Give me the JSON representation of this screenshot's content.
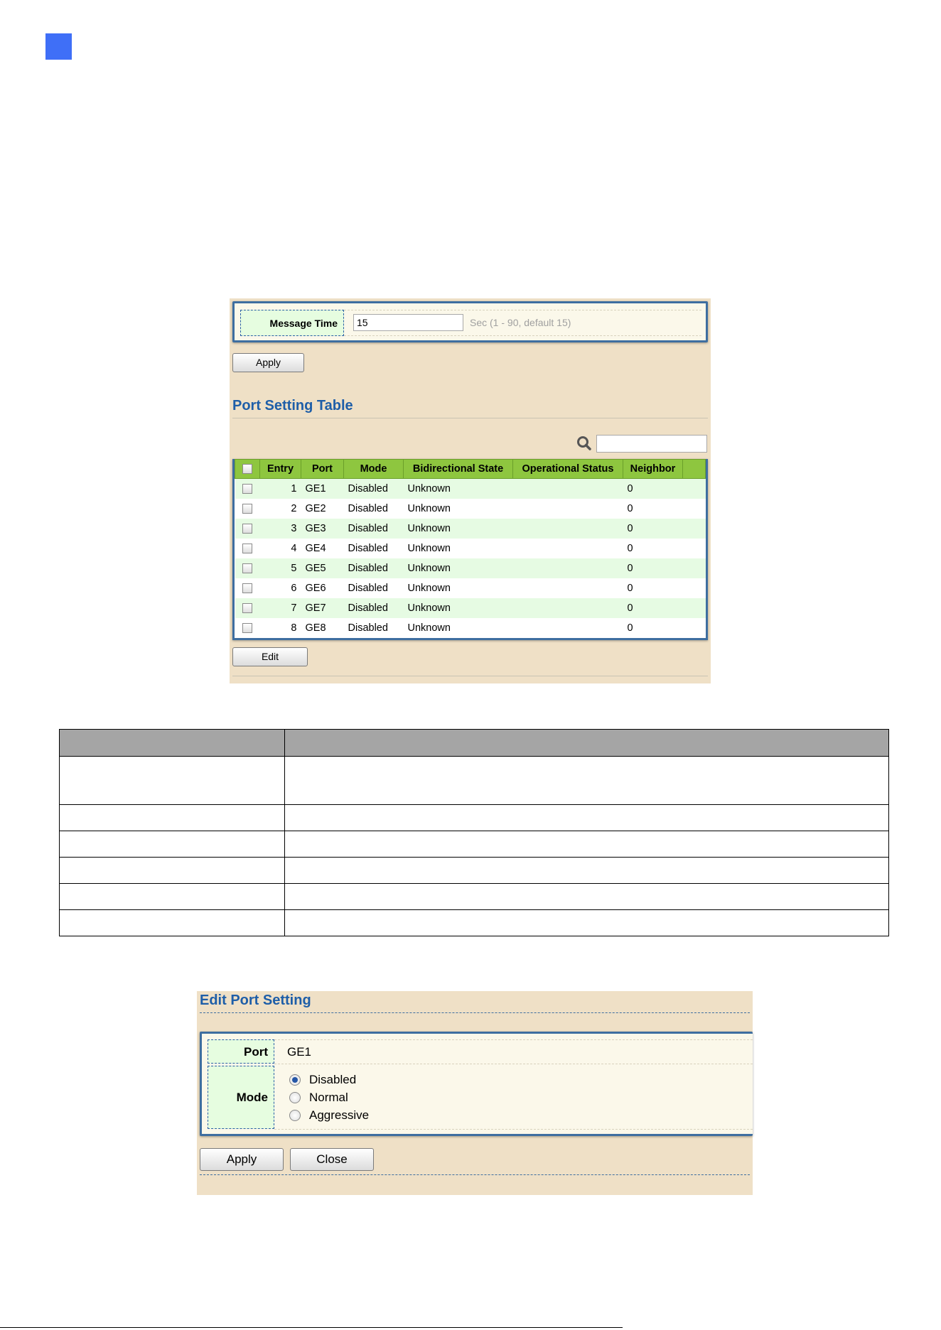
{
  "message_time": {
    "label": "Message Time",
    "value": "15",
    "hint": "Sec (1 - 90, default 15)",
    "apply_label": "Apply"
  },
  "port_table": {
    "title": "Port Setting Table",
    "columns": [
      "Entry",
      "Port",
      "Mode",
      "Bidirectional State",
      "Operational Status",
      "Neighbor"
    ],
    "rows": [
      {
        "entry": "1",
        "port": "GE1",
        "mode": "Disabled",
        "bidirectional": "Unknown",
        "operational": "",
        "neighbor": "0"
      },
      {
        "entry": "2",
        "port": "GE2",
        "mode": "Disabled",
        "bidirectional": "Unknown",
        "operational": "",
        "neighbor": "0"
      },
      {
        "entry": "3",
        "port": "GE3",
        "mode": "Disabled",
        "bidirectional": "Unknown",
        "operational": "",
        "neighbor": "0"
      },
      {
        "entry": "4",
        "port": "GE4",
        "mode": "Disabled",
        "bidirectional": "Unknown",
        "operational": "",
        "neighbor": "0"
      },
      {
        "entry": "5",
        "port": "GE5",
        "mode": "Disabled",
        "bidirectional": "Unknown",
        "operational": "",
        "neighbor": "0"
      },
      {
        "entry": "6",
        "port": "GE6",
        "mode": "Disabled",
        "bidirectional": "Unknown",
        "operational": "",
        "neighbor": "0"
      },
      {
        "entry": "7",
        "port": "GE7",
        "mode": "Disabled",
        "bidirectional": "Unknown",
        "operational": "",
        "neighbor": "0"
      },
      {
        "entry": "8",
        "port": "GE8",
        "mode": "Disabled",
        "bidirectional": "Unknown",
        "operational": "",
        "neighbor": "0"
      }
    ],
    "edit_label": "Edit"
  },
  "edit_port": {
    "title": "Edit Port Setting",
    "port_label": "Port",
    "port_value": "GE1",
    "mode_label": "Mode",
    "mode_options": [
      "Disabled",
      "Normal",
      "Aggressive"
    ],
    "mode_selected": "Disabled",
    "apply_label": "Apply",
    "close_label": "Close"
  },
  "colors": {
    "accent_blue": "#1e5ea8",
    "header_green": "#8ec63f",
    "panel_bg": "#efe0c6"
  }
}
